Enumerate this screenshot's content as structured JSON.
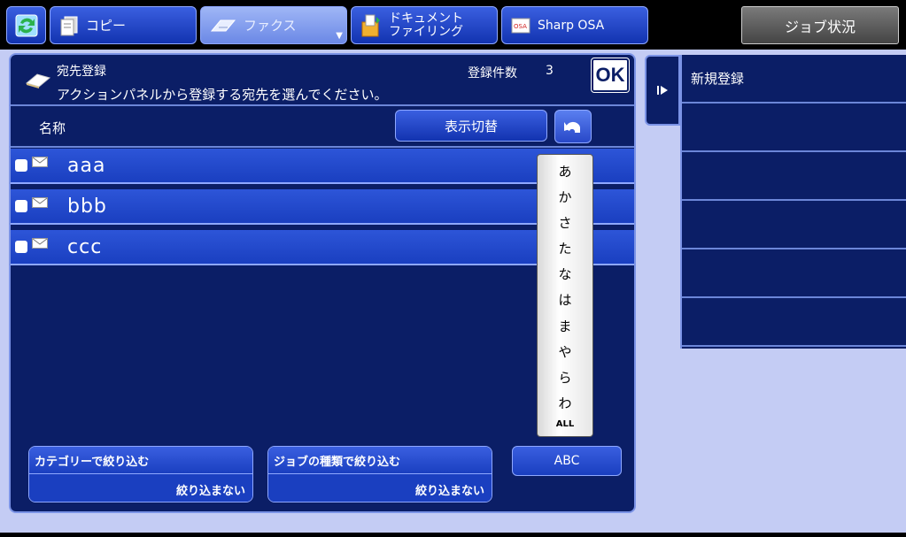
{
  "top_tabs": {
    "copy": "コピー",
    "fax": "ファクス",
    "doc_line1": "ドキュメント",
    "doc_line2": "ファイリング",
    "osa": "Sharp OSA",
    "job_status": "ジョブ状況"
  },
  "header": {
    "title": "宛先登録",
    "subtitle": "アクションパネルから登録する宛先を選んでください。",
    "count_label": "登録件数",
    "count_value": "3",
    "ok_label": "OK"
  },
  "list": {
    "column_name": "名称",
    "switch_label": "表示切替",
    "rows": [
      "aaa",
      "bbb",
      "ccc"
    ]
  },
  "kana_index": [
    "あ",
    "か",
    "さ",
    "た",
    "な",
    "は",
    "ま",
    "や",
    "ら",
    "わ",
    "ALL"
  ],
  "filters": {
    "category_title": "カテゴリーで絞り込む",
    "category_value": "絞り込まない",
    "jobtype_title": "ジョブの種類で絞り込む",
    "jobtype_value": "絞り込まない",
    "abc_label": "ABC"
  },
  "action_panel": {
    "items": [
      "新規登録",
      "",
      "",
      "",
      "",
      ""
    ]
  },
  "colors": {
    "panel_bg": "#0b1e66",
    "button_blue": "#1a3fc0",
    "page_bg": "#c4ccf4",
    "border": "#7b93e6"
  }
}
